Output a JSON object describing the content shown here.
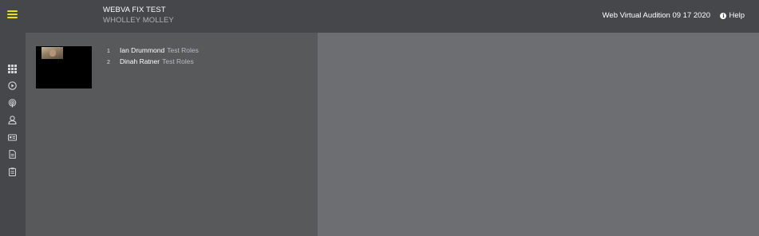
{
  "header": {
    "title": "WEBVA FIX TEST",
    "subtitle": "WHOLLEY MOLLEY",
    "session_name": "Web Virtual Audition 09 17 2020",
    "help_label": "Help"
  },
  "sidebar": {
    "items": [
      {
        "icon": "grid-icon"
      },
      {
        "icon": "play-circle-icon"
      },
      {
        "icon": "podcast-icon"
      },
      {
        "icon": "user-icon"
      },
      {
        "icon": "id-card-icon"
      },
      {
        "icon": "document-icon"
      },
      {
        "icon": "clipboard-icon"
      }
    ]
  },
  "participants": [
    {
      "number": "1",
      "name": "Ian Drummond",
      "role": "Test Roles"
    },
    {
      "number": "2",
      "name": "Dinah Ratner",
      "role": "Test Roles"
    }
  ],
  "colors": {
    "accent": "#e6e600",
    "topbar": "#45474a",
    "left_panel": "#58595b",
    "right_panel": "#6d6e71"
  }
}
